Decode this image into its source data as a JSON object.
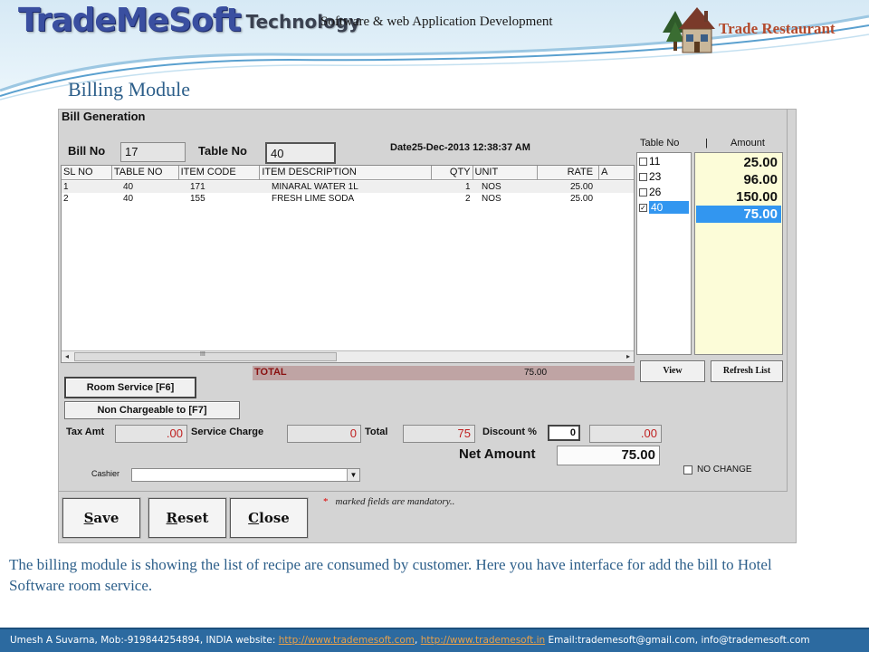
{
  "header": {
    "brand_name": "TradeMeSoft",
    "brand_suffix": "Technology",
    "tagline": "Software & web Application Development",
    "restaurant_label": "Trade Restaurant"
  },
  "slide_title": "Billing Module",
  "window": {
    "title": "Bill Generation",
    "bill_no_label": "Bill No",
    "bill_no_value": "17",
    "table_no_label": "Table No",
    "table_no_value": "40",
    "date_text": "Date25-Dec-2013 12:38:37 AM"
  },
  "grid": {
    "columns": [
      "SL NO",
      "TABLE NO",
      "ITEM CODE",
      "ITEM DESCRIPTION",
      "QTY",
      "UNIT",
      "RATE",
      "A"
    ],
    "rows": [
      {
        "sl": "1",
        "table": "40",
        "code": "171",
        "desc": "MINARAL WATER 1L",
        "qty": "1",
        "unit": "NOS",
        "rate": "25.00"
      },
      {
        "sl": "2",
        "table": "40",
        "code": "155",
        "desc": "FRESH LIME SODA",
        "qty": "2",
        "unit": "NOS",
        "rate": "25.00"
      }
    ],
    "scroll_mid": "III",
    "total_label": "TOTAL",
    "total_value": "75.00"
  },
  "table_panel": {
    "table_header": "Table No",
    "separator": "|",
    "amount_header": "Amount",
    "tables": [
      {
        "no": "11",
        "checked": false
      },
      {
        "no": "23",
        "checked": false
      },
      {
        "no": "26",
        "checked": false
      },
      {
        "no": "40",
        "checked": true
      }
    ],
    "check_mark": "✓",
    "amounts": [
      "25.00",
      "96.00",
      "150.00",
      "75.00"
    ],
    "view_label": "View",
    "refresh_label": "Refresh List"
  },
  "controls": {
    "room_service_label": "Room Service [F6]",
    "non_chargeable_label": "Non Chargeable to [F7]",
    "tax_amt_label": "Tax Amt",
    "tax_amt_value": ".00",
    "service_charge_label": "Service Charge",
    "service_charge_value": "0",
    "total_label": "Total",
    "total_value": "75",
    "discount_label": "Discount %",
    "discount_value": "0",
    "discount_amount": ".00",
    "net_amount_label": "Net Amount",
    "net_amount_value": "75.00",
    "cashier_label": "Cashier",
    "cashier_value": "",
    "no_change_label": "NO CHANGE"
  },
  "actions": {
    "save_first": "S",
    "save_rest": "ave",
    "reset_first": "R",
    "reset_rest": "eset",
    "close_first": "C",
    "close_rest": "lose",
    "mandatory_star": "*",
    "mandatory_note": "marked fields are mandatory.."
  },
  "description": "The billing module is showing the list of recipe are consumed by customer. Here you have interface for add the bill to Hotel Software room service.",
  "footer": {
    "contact": "Umesh A Suvarna, Mob:-919844254894, INDIA   website: ",
    "link1": "http://www.trademesoft.com",
    "sep": ",   ",
    "link2": "http://www.trademesoft.in",
    "emails": "   Email:trademesoft@gmail.com,  info@trademesoft.com"
  },
  "colors": {
    "accent_blue": "#2c6aa0",
    "selection_blue": "#3296f0",
    "title_blue": "#2d5f8a",
    "brand_red": "#b34a2c",
    "amount_panel_bg": "#fcfcd8"
  }
}
